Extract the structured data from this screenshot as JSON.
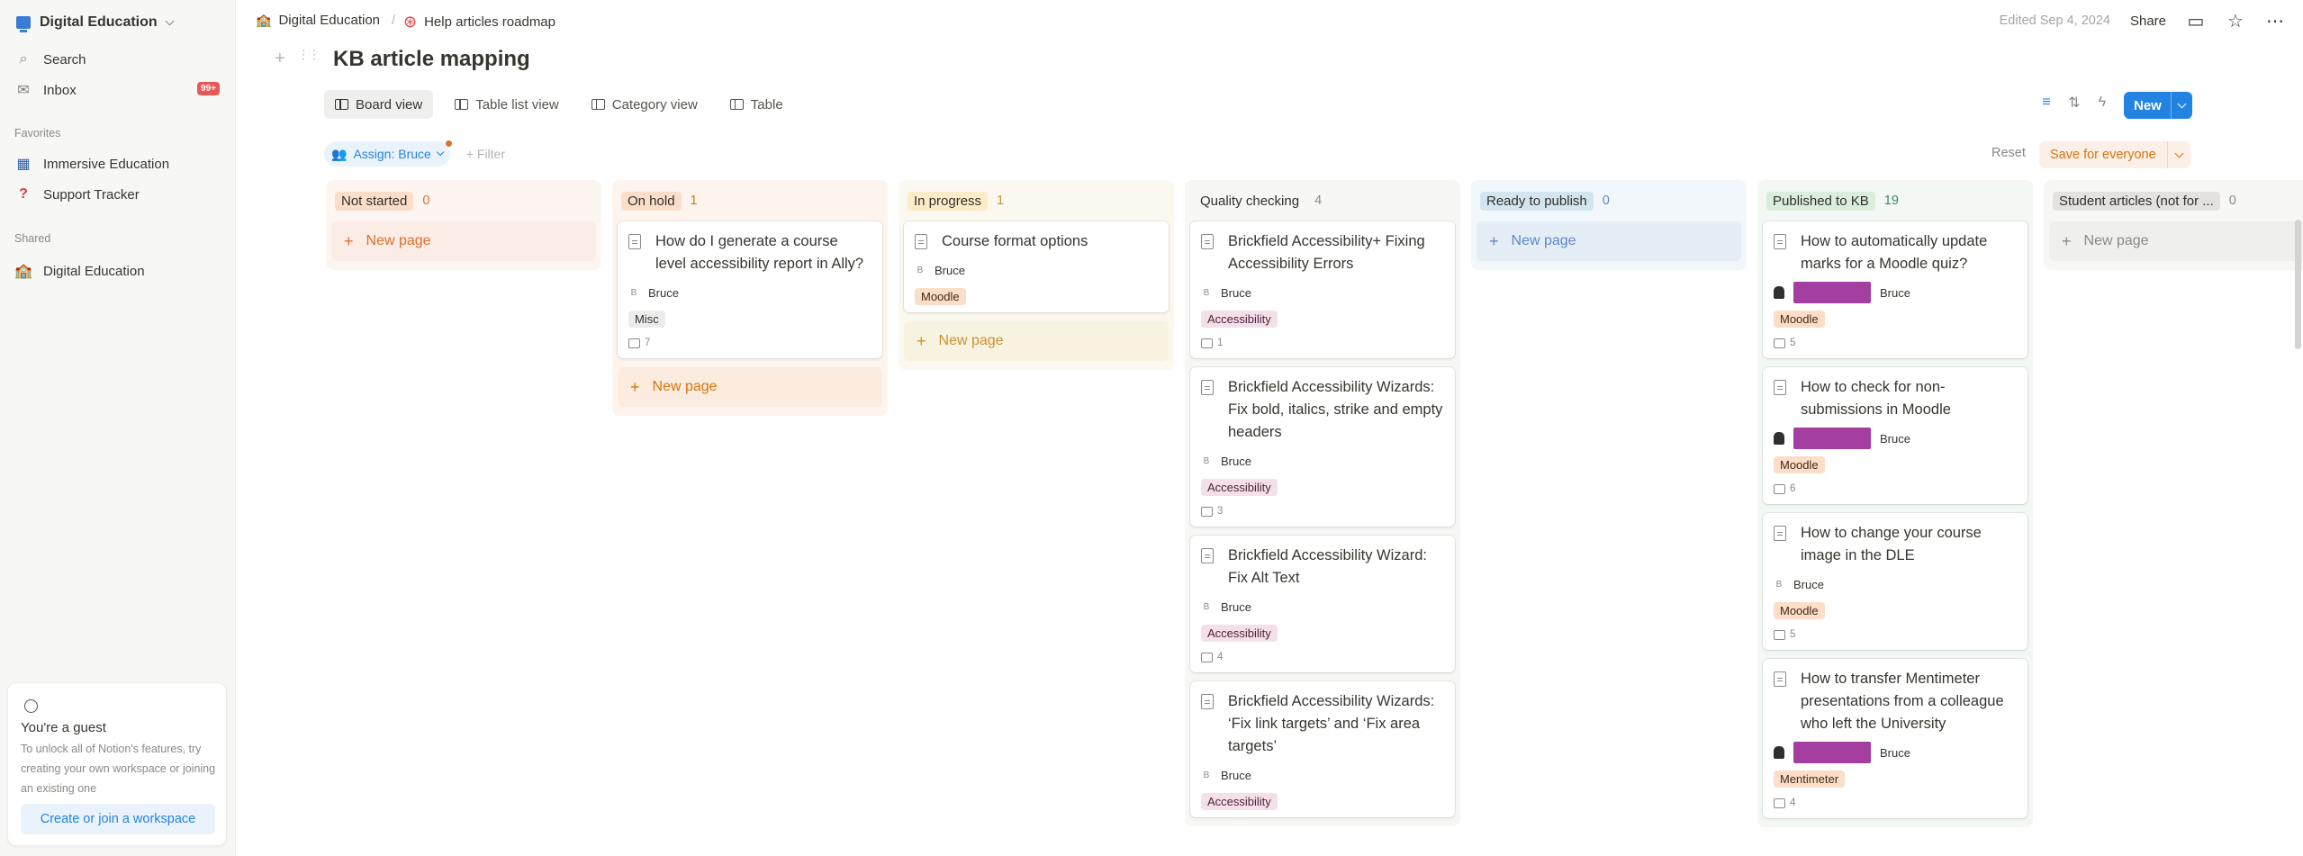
{
  "sidebar": {
    "workspace": "Digital Education",
    "search": "Search",
    "inbox": "Inbox",
    "inbox_badge": "99+",
    "favorites_heading": "Favorites",
    "favorites": [
      "Immersive Education",
      "Support Tracker"
    ],
    "shared_heading": "Shared",
    "shared": [
      "Digital Education"
    ],
    "guest": {
      "title": "You're a guest",
      "text": "To unlock all of Notion's features, try creating your own workspace or joining an existing one",
      "button": "Create or join a workspace"
    }
  },
  "topbar": {
    "crumb1": "Digital Education",
    "crumb2": "Help articles roadmap",
    "edited": "Edited Sep 4, 2024",
    "share": "Share"
  },
  "page": {
    "title": "KB article mapping"
  },
  "views": [
    "Board view",
    "Table list view",
    "Category view",
    "Table"
  ],
  "toolbar": {
    "new_label": "New"
  },
  "filter": {
    "assign": "Assign: Bruce",
    "add_filter": "Filter",
    "reset": "Reset",
    "save": "Save for everyone"
  },
  "colors": {
    "accent": "#2383e2",
    "tag_bar": "#a43ea1"
  },
  "columns": [
    {
      "name": "Not started",
      "count": "0",
      "bg": "#fdf5f2",
      "pill": "#fadec9",
      "countc": "#e16e2c",
      "cards": [],
      "new_page": "New page",
      "np_color": "#e16e2c",
      "np_bg": "#fbece5"
    },
    {
      "name": "On hold",
      "count": "1",
      "bg": "#fdf4ee",
      "pill": "#fadec9",
      "countc": "#d9730d",
      "cards": [
        {
          "title": "How do I generate a course level accessibility report in Ally?",
          "person": "Bruce",
          "tag": "Misc",
          "tagc": "misc",
          "comments": "7"
        }
      ],
      "new_page": "New page",
      "np_color": "#d9730d",
      "np_bg": "#fbecdf"
    },
    {
      "name": "In progress",
      "count": "1",
      "bg": "#fbf8ef",
      "pill": "#fdecc8",
      "countc": "#cb912f",
      "cards": [
        {
          "title": "Course format options",
          "person": "Bruce",
          "tag": "Moodle",
          "tagc": "moodle"
        }
      ],
      "new_page": "New page",
      "np_color": "#cb912f",
      "np_bg": "#f8f2e1"
    },
    {
      "name": "Quality checking",
      "count": "4",
      "bg": "#f7f7f5",
      "pill": "transparent",
      "countc": "#8a8984",
      "cards": [
        {
          "title": "Brickfield Accessibility+ Fixing Accessibility Errors",
          "person": "Bruce",
          "tag": "Accessibility",
          "tagc": "access",
          "comments": "1"
        },
        {
          "title": "Brickfield Accessibility Wizards: Fix bold, italics, strike and empty headers",
          "person": "Bruce",
          "tag": "Accessibility",
          "tagc": "access",
          "comments": "3"
        },
        {
          "title": "Brickfield Accessibility Wizard: Fix Alt Text",
          "person": "Bruce",
          "tag": "Accessibility",
          "tagc": "access",
          "comments": "4"
        },
        {
          "title": "Brickfield Accessibility Wizards: ‘Fix link targets’ and ‘Fix area targets’",
          "person": "Bruce",
          "tag": "Accessibility",
          "tagc": "access"
        }
      ]
    },
    {
      "name": "Ready to publish",
      "count": "0",
      "bg": "#f2f7fb",
      "pill": "#d3e5ef",
      "countc": "#5e87c9",
      "cards": [],
      "new_page": "New page",
      "np_color": "#5e87c9",
      "np_bg": "#e5eef6"
    },
    {
      "name": "Published to KB",
      "count": "19",
      "bg": "#f3f8f4",
      "pill": "#dbeddb",
      "countc": "#448361",
      "cards": [
        {
          "title": "How to automatically update marks for a Moodle quiz?",
          "person": "Bruce",
          "bar": true,
          "tag": "Moodle",
          "tagc": "moodle",
          "comments": "5"
        },
        {
          "title": "How to check for non-submissions in Moodle",
          "person": "Bruce",
          "bar": true,
          "tag": "Moodle",
          "tagc": "moodle",
          "comments": "6"
        },
        {
          "title": "How to change your course image in the DLE",
          "person": "Bruce",
          "tag": "Moodle",
          "tagc": "moodle",
          "comments": "5"
        },
        {
          "title": "How to transfer Mentimeter presentations from a colleague who left the University",
          "person": "Bruce",
          "bar": true,
          "tag": "Mentimeter",
          "tagc": "moodle",
          "comments": "4"
        }
      ]
    },
    {
      "name": "Student articles (not for ...",
      "count": "0",
      "bg": "#f7f7f5",
      "pill": "#e3e2e0",
      "countc": "#8a8984",
      "cards": [],
      "new_page": "New page",
      "np_color": "#8a8984",
      "np_bg": "#efefee"
    }
  ]
}
